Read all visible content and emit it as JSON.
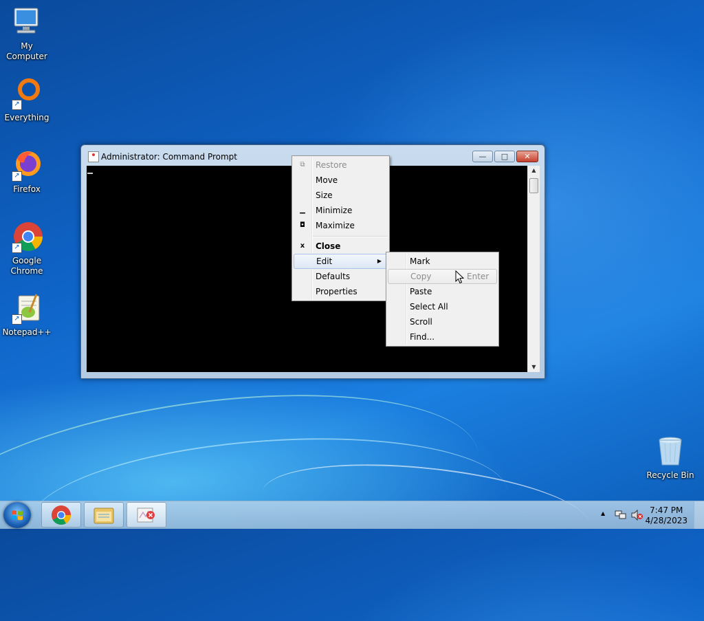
{
  "desktop": {
    "icons": [
      {
        "label": "My Computer"
      },
      {
        "label": "Everything"
      },
      {
        "label": "Firefox"
      },
      {
        "label": "Google Chrome"
      },
      {
        "label": "Notepad++"
      },
      {
        "label": "Recycle Bin"
      }
    ]
  },
  "window": {
    "title": "Administrator:  Command Prompt",
    "minimize_glyph": "—",
    "maximize_glyph": "□",
    "close_glyph": "✕"
  },
  "system_menu": {
    "items": [
      {
        "label": "Restore",
        "glyph": "⧉",
        "state": "disabled"
      },
      {
        "label": "Move"
      },
      {
        "label": "Size"
      },
      {
        "label": "Minimize",
        "glyph": "▁"
      },
      {
        "label": "Maximize",
        "glyph": "◘"
      },
      {
        "label": "Close",
        "glyph": "x",
        "state": "bold"
      },
      {
        "label": "Edit",
        "submenu": true
      },
      {
        "label": "Defaults"
      },
      {
        "label": "Properties"
      }
    ]
  },
  "edit_menu": {
    "items": [
      {
        "label": "Mark"
      },
      {
        "label": "Copy",
        "shortcut": "Enter",
        "state": "disabled"
      },
      {
        "label": "Paste"
      },
      {
        "label": "Select All"
      },
      {
        "label": "Scroll"
      },
      {
        "label": "Find..."
      }
    ]
  },
  "taskbar": {
    "time": "7:47 PM",
    "date": "4/28/2023",
    "tray_arrow": "▲"
  },
  "colors": {
    "console_bg": "#000000",
    "menu_highlight": "#dde8f5"
  }
}
